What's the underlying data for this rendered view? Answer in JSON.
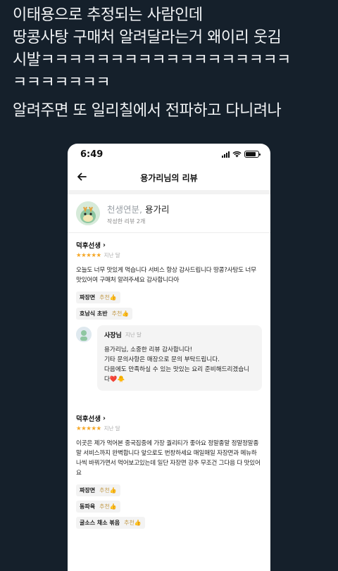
{
  "tweet": {
    "lines": [
      "이태용으로 추정되는 사람인데",
      "땅콩사탕 구매처 알려달라는거 왜이리 웃김",
      "시발ㅋㅋㅋㅋㅋㅋㅋㅋㅋㅋㅋㅋㅋㅋㅋㅋㅋㅋ",
      "ㅋㅋㅋㅋㅋㅋㅋ",
      "알려주면 또 일리칠에서 전파하고 다니려나"
    ]
  },
  "phone": {
    "status_time": "6:49",
    "nav_title": "용가리님의 리뷰",
    "profile": {
      "prefix": "천생연분,",
      "name": " 용가리",
      "sub": "작성한 리뷰 2개"
    },
    "reviews": [
      {
        "author": "덕후선생",
        "stars": "★★★★★",
        "date": "지난 달",
        "text": "오늘도 너무 맛있게 먹습니다 서비스 항상 감사드립니다 땅콩?사탕도 너무 맛있어여 구매처 알려주세요 감사합니다아",
        "menus": [
          {
            "name": "짜장면",
            "rec": "추천"
          },
          {
            "name": "호남식 초반",
            "rec": "추천"
          }
        ],
        "owner_reply": {
          "name": "사장님",
          "date": "지난 달",
          "text": "용가리님, 소중한 리뷰 감사합니다!\n기타 문의사항은 매장으로 문의 부탁드립니다.\n다음에도 만족하실 수 있는 맛있는 요리 준비해드리겠습니다❤️🐥"
        }
      },
      {
        "author": "덕후선생",
        "stars": "★★★★★",
        "date": "지난 달",
        "text": "이곳은 제가 먹어본 중국집중에 가장 퀄리티가 좋아요 정말종말 정말정말종말 서비스까지 완벽합니다 앞으로도 번창하세요 매일매일 자장면과 메뉴하나씩 바꿔가면서 먹어보고있는데 일단 자장면 강추 무조건 그다음 다 맛있어요",
        "menus": [
          {
            "name": "짜장면",
            "rec": "추천"
          },
          {
            "name": "동파육",
            "rec": "추천"
          },
          {
            "name": "굴소스 채소 볶음",
            "rec": "추천"
          }
        ]
      }
    ]
  }
}
